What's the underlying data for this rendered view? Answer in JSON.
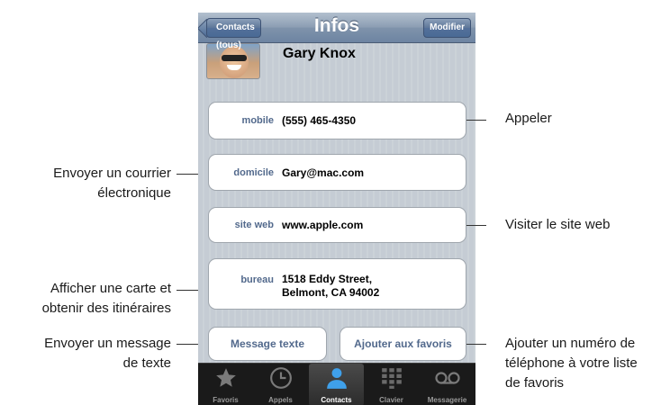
{
  "navbar": {
    "title": "Infos",
    "back_label": "Contacts (tous)",
    "edit_label": "Modifier"
  },
  "contact": {
    "name": "Gary Knox"
  },
  "fields": [
    {
      "label": "mobile",
      "value": "(555) 465-4350"
    },
    {
      "label": "domicile",
      "value": "Gary@mac.com"
    },
    {
      "label": "site web",
      "value": "www.apple.com"
    },
    {
      "label": "bureau",
      "value_line1": "1518 Eddy Street,",
      "value_line2": "Belmont, CA 94002"
    }
  ],
  "actions": {
    "text_message": "Message texte",
    "add_favorites": "Ajouter aux favoris"
  },
  "tabbar": {
    "items": [
      {
        "label": "Favoris",
        "icon": "star-icon"
      },
      {
        "label": "Appels",
        "icon": "clock-icon"
      },
      {
        "label": "Contacts",
        "icon": "person-icon",
        "active": true
      },
      {
        "label": "Clavier",
        "icon": "keypad-icon"
      },
      {
        "label": "Messagerie",
        "icon": "voicemail-icon"
      }
    ]
  },
  "callouts": {
    "call": "Appeler",
    "email_line1": "Envoyer un courrier",
    "email_line2": "électronique",
    "website": "Visiter le site web",
    "map_line1": "Afficher une carte et",
    "map_line2": "obtenir des itinéraires",
    "sms_line1": "Envoyer un message",
    "sms_line2": "de texte",
    "fav_line1": "Ajouter un numéro de",
    "fav_line2": "téléphone à votre liste",
    "fav_line3": "de favoris"
  },
  "colors": {
    "label_blue": "#52698c",
    "navbar": "#6d84a2",
    "background": "#c5ccd4"
  }
}
